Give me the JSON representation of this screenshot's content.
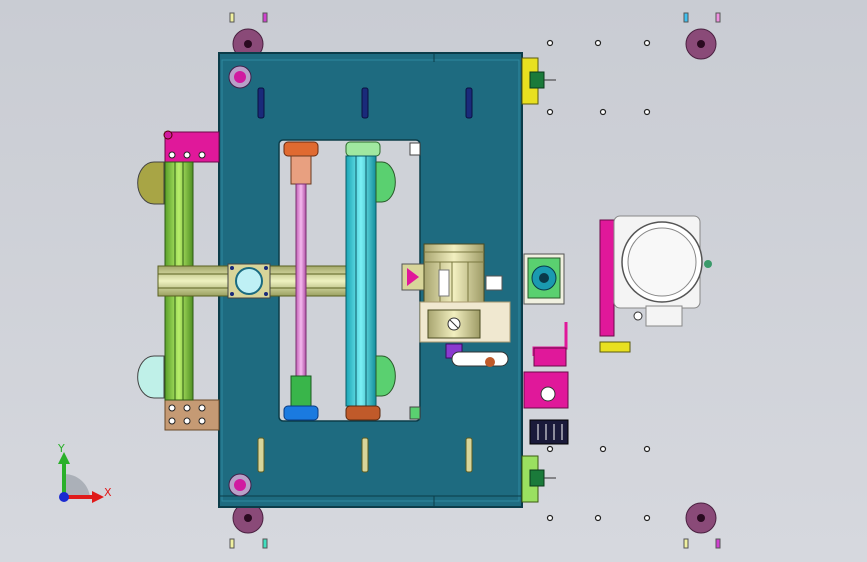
{
  "viewport": {
    "background": "#cfd2d8"
  },
  "colors": {
    "frame_plate": "#1e6b80",
    "frame_edge": "#0b3c49",
    "rail_green": "#8fd04a",
    "rail_cyan": "#2ac9d9",
    "rod_pink": "#e58ad9",
    "block_magenta": "#e0189a",
    "block_tan": "#c59a74",
    "motor_olive": "#d8d59a",
    "accent_yellow": "#e8e020",
    "wheel_purple": "#8a4a78",
    "bolt_navy": "#1a2a7a"
  },
  "triad": {
    "x_label": "X",
    "y_label": "Y"
  }
}
